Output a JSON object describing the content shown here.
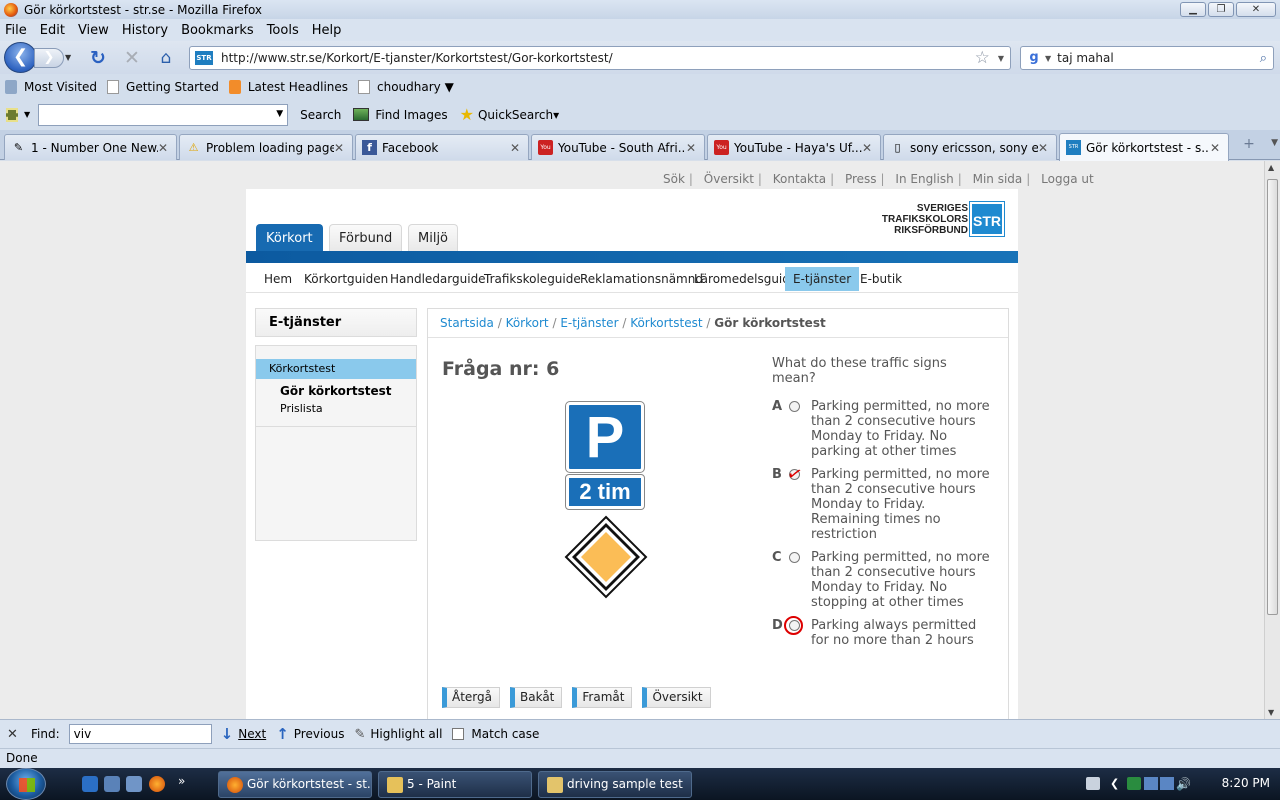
{
  "window": {
    "title": "Gör körkortstest - str.se - Mozilla Firefox",
    "controls": [
      "minimize",
      "maximize",
      "close"
    ]
  },
  "menubar": [
    "File",
    "Edit",
    "View",
    "History",
    "Bookmarks",
    "Tools",
    "Help"
  ],
  "navbar": {
    "url": "http://www.str.se/Korkort/E-tjanster/Korkortstest/Gor-korkortstest/",
    "site_icon_text": "STR",
    "search_value": "taj mahal"
  },
  "bookmarks": [
    "Most Visited",
    "Getting Started",
    "Latest Headlines",
    "choudhary ▼"
  ],
  "toolbar2": {
    "search_label": "Search",
    "find_images_label": "Find Images",
    "quicksearch_label": "QuickSearch▾"
  },
  "tabs": [
    {
      "label": "1 - Number One New...",
      "icon": "site-icon"
    },
    {
      "label": "Problem loading page",
      "icon": "warning-icon"
    },
    {
      "label": "Facebook",
      "icon": "facebook-icon"
    },
    {
      "label": "YouTube - South Afri...",
      "icon": "youtube-icon"
    },
    {
      "label": "YouTube - Haya's Uf...",
      "icon": "youtube-icon"
    },
    {
      "label": "sony ericsson, sony e...",
      "icon": "page-icon"
    },
    {
      "label": "Gör körkortstest - s...",
      "icon": "str-icon"
    }
  ],
  "page": {
    "toplinks": [
      "Sök",
      "Översikt",
      "Kontakta",
      "Press",
      "In English",
      "Min sida",
      "Logga ut"
    ],
    "logo": {
      "line1": "SVERIGES",
      "line2": "TRAFIKSKOLORS",
      "line3": "RIKSFÖRBUND",
      "box": "STR"
    },
    "main_tabs": [
      "Körkort",
      "Förbund",
      "Miljö"
    ],
    "subnav": [
      "Hem",
      "Körkortguiden",
      "Handledarguide",
      "Trafikskoleguide",
      "Reklamationsnämnd",
      "Läromedelsguide",
      "E-tjänster",
      "E-butik"
    ],
    "sidebar": {
      "heading": "E-tjänster",
      "active": "Körkortstest",
      "items": [
        "Gör körkortstest",
        "Prislista"
      ]
    },
    "breadcrumb": {
      "links": [
        "Startsida",
        "Körkort",
        "E-tjänster",
        "Körkortstest"
      ],
      "current": "Gör körkortstest"
    },
    "question_title": "Fråga nr: 6",
    "signs": {
      "p": "P",
      "tim": "2 tim"
    },
    "question": "What do these traffic signs mean?",
    "answers": [
      {
        "letter": "A",
        "text": "Parking permitted, no more than 2 consecutive hours Monday to Friday. No parking at other times"
      },
      {
        "letter": "B",
        "text": "Parking permitted, no more than 2 consecutive hours Monday to Friday. Remaining times no restriction"
      },
      {
        "letter": "C",
        "text": "Parking permitted, no more than 2 consecutive hours Monday to Friday. No stopping at other times"
      },
      {
        "letter": "D",
        "text": "Parking always permitted for no more than 2 hours"
      }
    ],
    "buttons": [
      "Återgå",
      "Bakåt",
      "Framåt",
      "Översikt"
    ],
    "colors": {
      "brand_blue": "#176ab1",
      "highlight": "#8ac9ec",
      "sign_blue": "#1a6fb8",
      "sign_yellow": "#fbbd56",
      "mark_red": "#dd0000"
    }
  },
  "findbar": {
    "label": "Find:",
    "value": "viv",
    "next": "Next",
    "previous": "Previous",
    "highlight": "Highlight all",
    "match_case": "Match case"
  },
  "status": "Done",
  "taskbar": {
    "windows": [
      "Gör körkortstest - st...",
      "5 - Paint",
      "driving sample test"
    ],
    "clock": "8:20 PM"
  }
}
